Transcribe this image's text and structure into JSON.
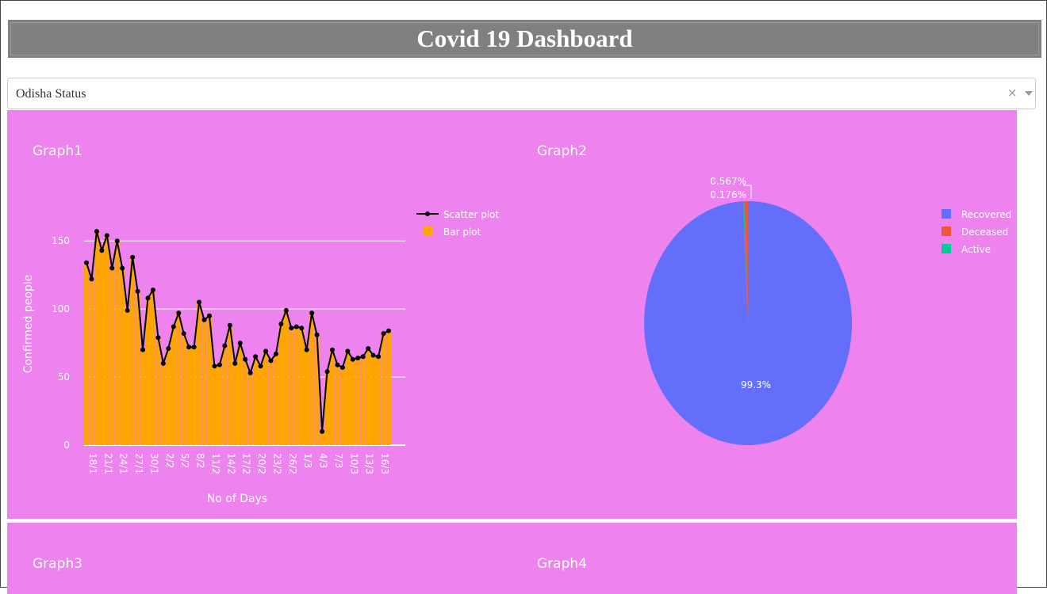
{
  "header": {
    "title": "Covid 19 Dashboard"
  },
  "dropdown": {
    "value": "Odisha Status"
  },
  "graphs": {
    "g1_title": "Graph1",
    "g2_title": "Graph2",
    "g3_title": "Graph3",
    "g4_title": "Graph4"
  },
  "colors": {
    "panel": "#ee82ee",
    "bar": "#ffa500",
    "recovered": "#636efa",
    "deceased": "#ef553b",
    "active": "#00cc96"
  },
  "chart_data": [
    {
      "type": "bar",
      "xlabel": "No of Days",
      "ylabel": "Confirmed people",
      "ylim": [
        0,
        160
      ],
      "yticks": [
        0,
        50,
        100,
        150
      ],
      "x_ticks": [
        "18/1",
        "21/1",
        "24/1",
        "27/1",
        "30/1",
        "2/2",
        "5/2",
        "8/2",
        "11/2",
        "14/2",
        "17/2",
        "20/2",
        "23/2",
        "26/2",
        "1/3",
        "4/3",
        "7/3",
        "10/3",
        "13/3",
        "16/3"
      ],
      "legend": [
        "Scatter plot",
        "Bar plot"
      ],
      "legend_position": "top-right",
      "series": [
        {
          "name": "Scatter plot",
          "type": "line",
          "values": [
            134,
            122,
            157,
            143,
            154,
            130,
            150,
            130,
            99,
            138,
            113,
            70,
            108,
            114,
            79,
            60,
            71,
            87,
            97,
            82,
            72,
            72,
            105,
            92,
            95,
            58,
            59,
            73,
            88,
            60,
            75,
            63,
            53,
            65,
            58,
            69,
            62,
            67,
            89,
            99,
            86,
            87,
            86,
            70,
            97,
            81,
            10,
            54,
            70,
            59,
            57,
            69,
            63,
            64,
            65,
            71,
            66,
            65,
            82,
            84
          ]
        },
        {
          "name": "Bar plot",
          "type": "bar",
          "values": [
            134,
            122,
            157,
            143,
            154,
            130,
            150,
            130,
            99,
            138,
            113,
            70,
            108,
            114,
            79,
            60,
            71,
            87,
            97,
            82,
            72,
            72,
            105,
            92,
            95,
            58,
            59,
            73,
            88,
            60,
            75,
            63,
            53,
            65,
            58,
            69,
            62,
            67,
            89,
            99,
            86,
            87,
            86,
            70,
            97,
            81,
            10,
            54,
            70,
            59,
            57,
            69,
            63,
            64,
            65,
            71,
            66,
            65,
            82,
            84
          ]
        }
      ]
    },
    {
      "type": "pie",
      "legend": [
        "Recovered",
        "Deceased",
        "Active"
      ],
      "legend_position": "top-right",
      "slices": [
        {
          "name": "Recovered",
          "value": 99.3,
          "label": "99.3%"
        },
        {
          "name": "Deceased",
          "value": 0.567,
          "label": "0.567%"
        },
        {
          "name": "Active",
          "value": 0.176,
          "label": "0.176%"
        }
      ]
    }
  ]
}
